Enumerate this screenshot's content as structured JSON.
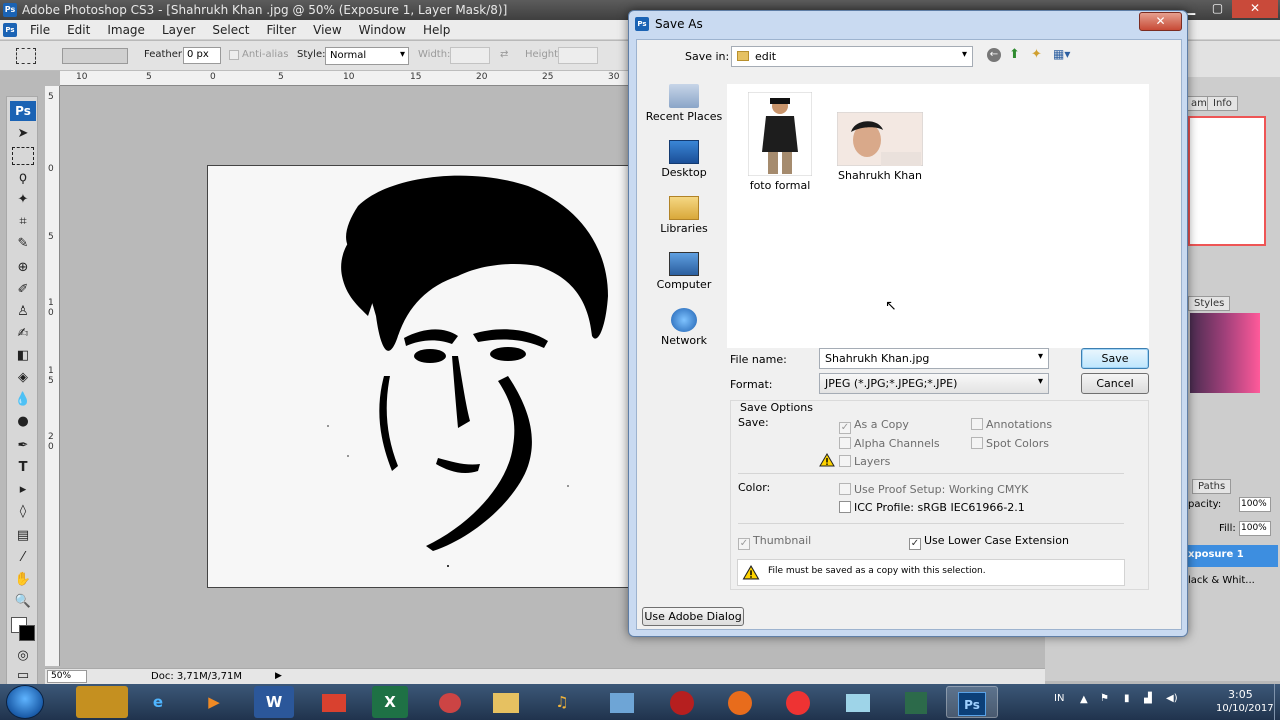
{
  "photoshop": {
    "logo": "Ps",
    "title": "Adobe Photoshop CS3 - [Shahrukh Khan .jpg @ 50% (Exposure 1, Layer Mask/8)]",
    "menu": [
      "File",
      "Edit",
      "Image",
      "Layer",
      "Select",
      "Filter",
      "View",
      "Window",
      "Help"
    ],
    "options": {
      "feather_label": "Feather:",
      "feather_value": "0 px",
      "antialias_label": "Anti-alias",
      "style_label": "Style:",
      "style_value": "Normal",
      "width_label": "Width:",
      "height_label": "Height:"
    },
    "ruler_top": [
      "10",
      "5",
      "0",
      "5",
      "10",
      "15",
      "20",
      "25",
      "30"
    ],
    "ruler_left": [
      "5",
      "0",
      "5",
      "1",
      "0",
      "1",
      "5",
      "2",
      "0"
    ],
    "status": {
      "zoom": "50%",
      "doc": "Doc: 3,71M/3,71M"
    },
    "panels": {
      "tab_hist": "am",
      "tab_info": "Info",
      "styles_tab": "Styles",
      "paths_tab": "Paths",
      "opacity_label": "pacity:",
      "opacity_value": "100%",
      "fill_label": "Fill:",
      "fill_value": "100%",
      "layer1": "xposure 1",
      "layer2": "lack & Whit..."
    }
  },
  "dialog": {
    "title": "Save As",
    "save_in_label": "Save in:",
    "save_in_value": "edit",
    "places": [
      "Recent Places",
      "Desktop",
      "Libraries",
      "Computer",
      "Network"
    ],
    "files": [
      "foto formal",
      "Shahrukh Khan"
    ],
    "file_name_label": "File name:",
    "file_name_value": "Shahrukh Khan.jpg",
    "format_label": "Format:",
    "format_value": "JPEG (*.JPG;*.JPEG;*.JPE)",
    "save_button": "Save",
    "cancel_button": "Cancel",
    "save_options_header": "Save Options",
    "save_label": "Save:",
    "as_a_copy": "As a Copy",
    "annotations": "Annotations",
    "alpha_channels": "Alpha Channels",
    "spot_colors": "Spot Colors",
    "layers": "Layers",
    "color_label": "Color:",
    "use_proof_setup": "Use Proof Setup:  Working CMYK",
    "icc_profile": "ICC Profile:  sRGB IEC61966-2.1",
    "thumbnail": "Thumbnail",
    "use_lower_case": "Use Lower Case Extension",
    "message": "File must be saved as a copy with this selection.",
    "use_adobe_dialog": "Use Adobe Dialog"
  },
  "taskbar": {
    "apps": [
      "",
      "e",
      "▶",
      "W",
      "",
      "X",
      "",
      "",
      "♫",
      "",
      "",
      "",
      "",
      "",
      "",
      "Ps"
    ],
    "lang": "IN",
    "time": "3:05",
    "date": "10/10/2017"
  }
}
